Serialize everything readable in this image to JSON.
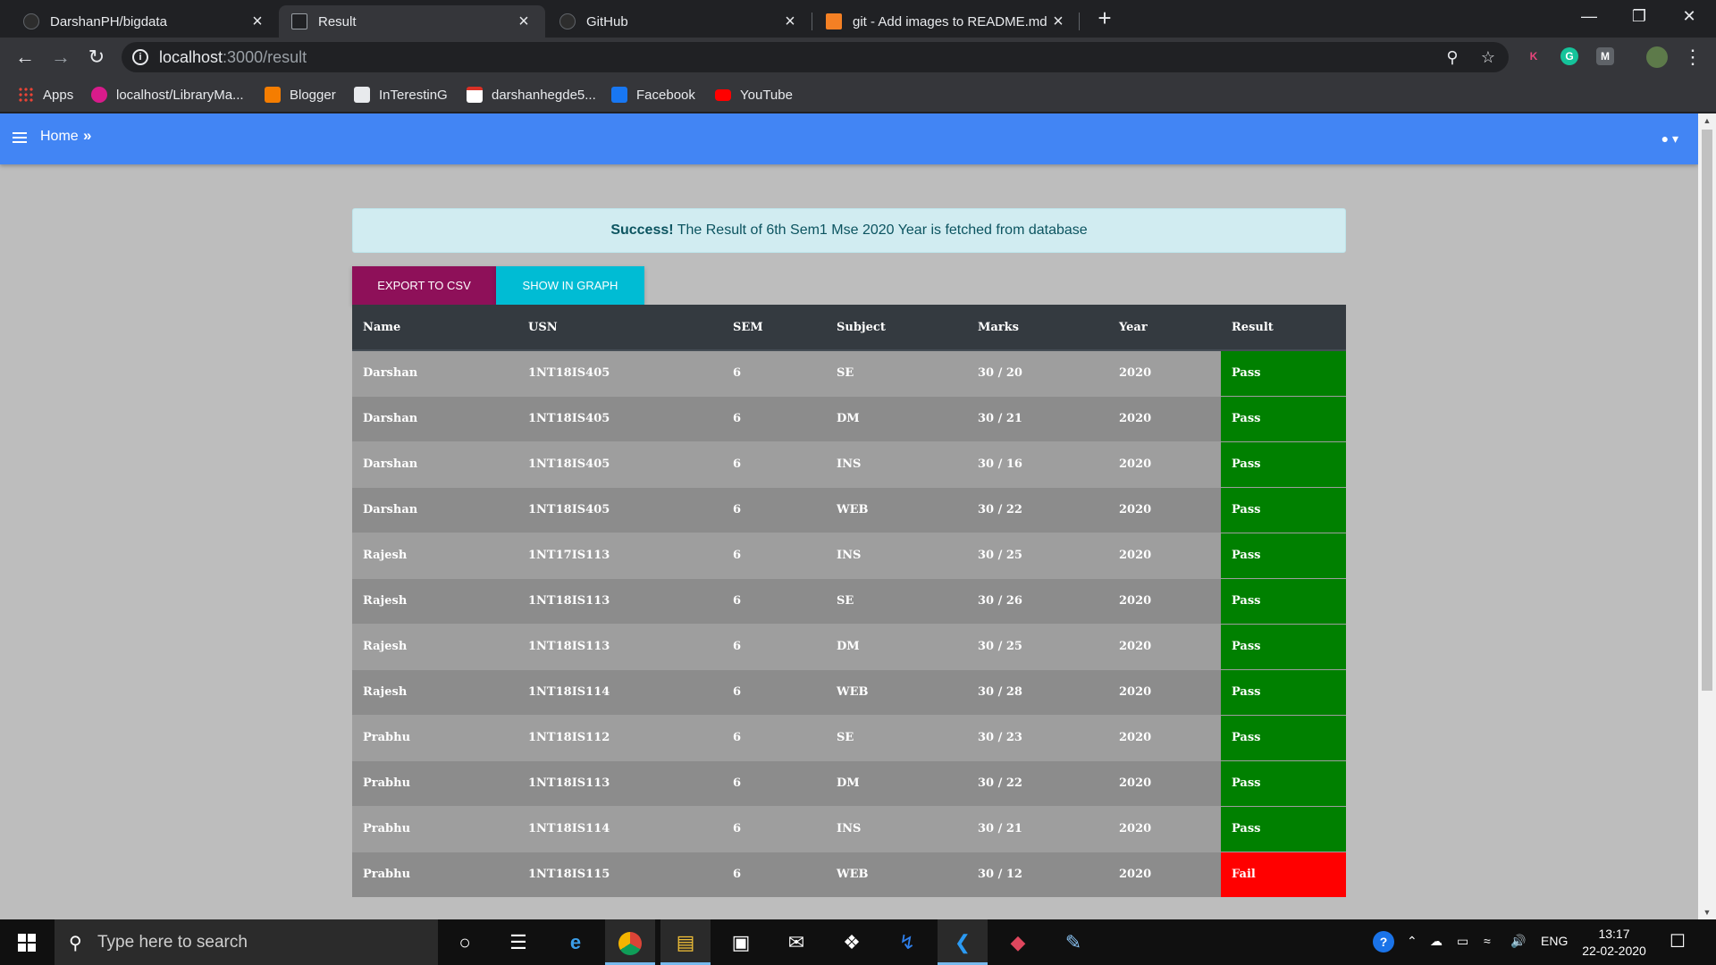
{
  "browser": {
    "tabs": [
      {
        "title": "DarshanPH/bigdata",
        "active": false
      },
      {
        "title": "Result",
        "active": true
      },
      {
        "title": "GitHub",
        "active": false
      },
      {
        "title": "git - Add images to README.md",
        "active": false
      }
    ],
    "address": {
      "host": "localhost",
      "path": ":3000/result"
    },
    "bookmarks": [
      {
        "label": "Apps",
        "icon": "apps-grid-icon"
      },
      {
        "label": "localhost/LibraryMa...",
        "icon": "library-icon"
      },
      {
        "label": "Blogger",
        "icon": "blogger-icon"
      },
      {
        "label": "InTerestinG",
        "icon": "folder-thumbnail-icon"
      },
      {
        "label": "darshanhegde5...",
        "icon": "gmail-icon"
      },
      {
        "label": "Facebook",
        "icon": "facebook-icon"
      },
      {
        "label": "YouTube",
        "icon": "youtube-icon"
      }
    ],
    "extensions": [
      "K",
      "G",
      "M"
    ]
  },
  "page": {
    "breadcrumb": "Home",
    "alert": {
      "strong": "Success!",
      "text": " The Result of 6th Sem1 Mse 2020 Year is fetched from database"
    },
    "buttons": {
      "export": "Export to CSV",
      "graph": "Show in Graph"
    },
    "table": {
      "headers": [
        "Name",
        "USN",
        "SEM",
        "Subject",
        "Marks",
        "Year",
        "Result"
      ],
      "rows": [
        [
          "Darshan",
          "1NT18IS405",
          "6",
          "SE",
          "30 / 20",
          "2020",
          "Pass"
        ],
        [
          "Darshan",
          "1NT18IS405",
          "6",
          "DM",
          "30 / 21",
          "2020",
          "Pass"
        ],
        [
          "Darshan",
          "1NT18IS405",
          "6",
          "INS",
          "30 / 16",
          "2020",
          "Pass"
        ],
        [
          "Darshan",
          "1NT18IS405",
          "6",
          "WEB",
          "30 / 22",
          "2020",
          "Pass"
        ],
        [
          "Rajesh",
          "1NT17IS113",
          "6",
          "INS",
          "30 / 25",
          "2020",
          "Pass"
        ],
        [
          "Rajesh",
          "1NT18IS113",
          "6",
          "SE",
          "30 / 26",
          "2020",
          "Pass"
        ],
        [
          "Rajesh",
          "1NT18IS113",
          "6",
          "DM",
          "30 / 25",
          "2020",
          "Pass"
        ],
        [
          "Rajesh",
          "1NT18IS114",
          "6",
          "WEB",
          "30 / 28",
          "2020",
          "Pass"
        ],
        [
          "Prabhu",
          "1NT18IS112",
          "6",
          "SE",
          "30 / 23",
          "2020",
          "Pass"
        ],
        [
          "Prabhu",
          "1NT18IS113",
          "6",
          "DM",
          "30 / 22",
          "2020",
          "Pass"
        ],
        [
          "Prabhu",
          "1NT18IS114",
          "6",
          "INS",
          "30 / 21",
          "2020",
          "Pass"
        ],
        [
          "Prabhu",
          "1NT18IS115",
          "6",
          "WEB",
          "30 / 12",
          "2020",
          "Fail"
        ]
      ]
    },
    "colors": {
      "appbar": "#4285f4",
      "pass": "#008000",
      "fail": "#ff0000",
      "export": "#8e1059",
      "graph": "#00bcd4"
    }
  },
  "taskbar": {
    "search_placeholder": "Type here to search",
    "language": "ENG",
    "time": "13:17",
    "date": "22-02-2020"
  }
}
